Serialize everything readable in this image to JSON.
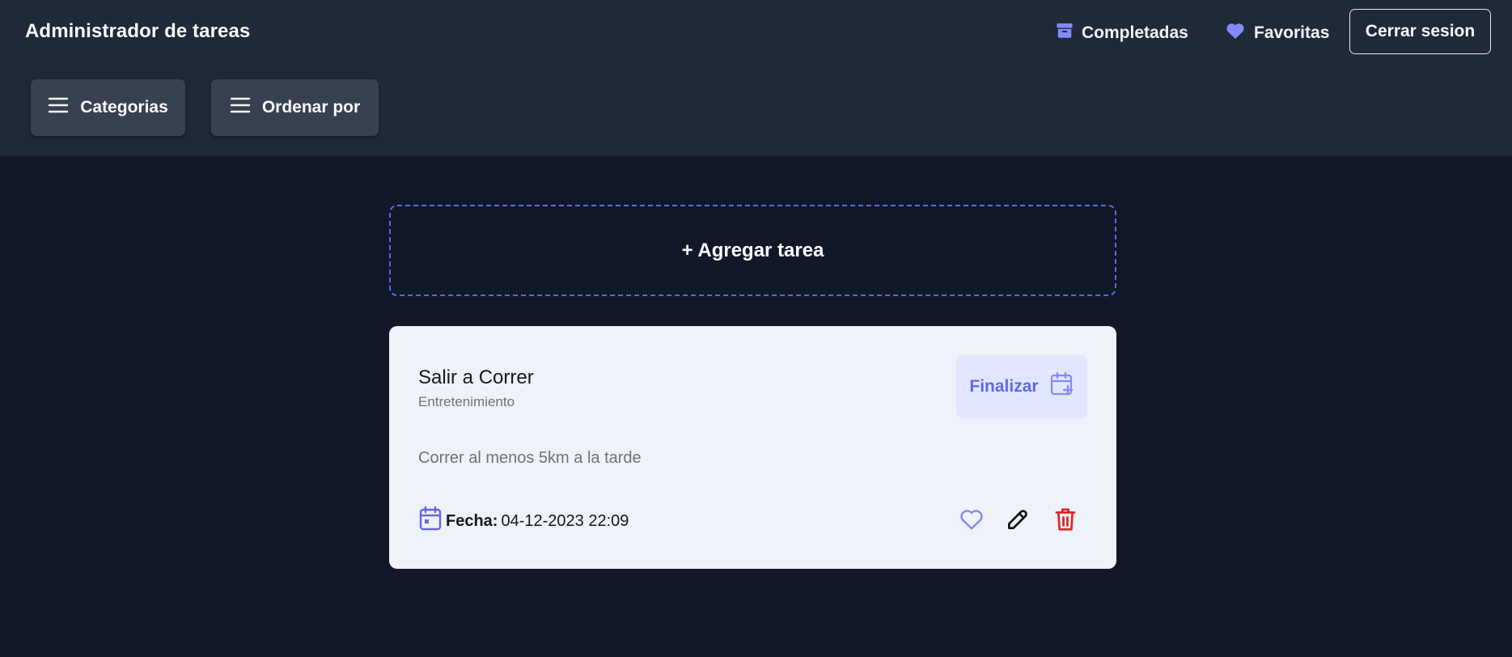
{
  "header": {
    "title": "Administrador de tareas",
    "nav": {
      "completed_label": "Completadas",
      "completed_icon": "archive-icon",
      "favorites_label": "Favoritas",
      "favorites_icon": "heart-icon"
    },
    "logout_label": "Cerrar sesion",
    "filters": {
      "categories_label": "Categorias",
      "sort_label": "Ordenar por",
      "icon": "menu-icon"
    }
  },
  "main": {
    "add_task_label": "+ Agregar tarea",
    "tasks": [
      {
        "title": "Salir a Correr",
        "category": "Entretenimiento",
        "description": "Correr al menos 5km a la tarde",
        "date_label": "Fecha:",
        "date_value": "04-12-2023 22:09",
        "finish_label": "Finalizar",
        "actions": [
          "heart-icon",
          "edit-icon",
          "trash-icon"
        ]
      }
    ]
  },
  "colors": {
    "page_bg": "#111827",
    "header_bg": "#1f2937",
    "button_bg": "#374151",
    "accent": "#6366f1",
    "accent_light": "#818cf8",
    "card_bg": "#eff2f8",
    "finish_bg": "#e0e7ff",
    "delete": "#dc2626"
  }
}
